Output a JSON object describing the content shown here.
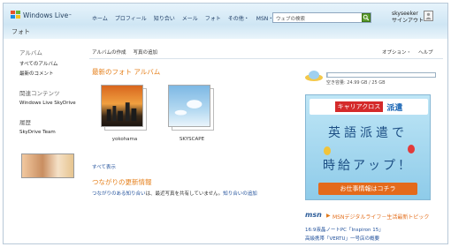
{
  "header": {
    "brand": "Windows Live",
    "trademark": "™",
    "page_title": "フォト",
    "nav": [
      "ホーム",
      "プロフィール",
      "知り合い",
      "メール",
      "フォト",
      "その他・",
      "MSN・"
    ],
    "search_placeholder": "ウェブの検索",
    "user_name": "skyseeker",
    "signout": "サインアウト"
  },
  "sidebar": {
    "album_title": "アルバム",
    "album_items": [
      "すべてのアルバム",
      "最新のコメント"
    ],
    "related_title": "関連コンテンツ",
    "related_items": [
      "Windows Live SkyDrive"
    ],
    "history_title": "履歴",
    "history_items": [
      "SkyDrive Team"
    ]
  },
  "toolbar": {
    "left": [
      "アルバムの作成",
      "写真の追加"
    ],
    "right": [
      "オプション・",
      "ヘルプ"
    ]
  },
  "main": {
    "recent_title": "最新のフォト アルバム",
    "albums": [
      {
        "label": "yokohama"
      },
      {
        "label": "SKYSCAPE"
      }
    ],
    "show_all": "すべて表示",
    "updates_title": "つながりの更新情報",
    "updates_link1": "つながりのある知り合い",
    "updates_text": "は、最近写真を共有していません。",
    "updates_link2": "知り合いの追加"
  },
  "storage": {
    "label": "空き容量: 24.99 GB / 25 GB",
    "used_fraction": 0.004
  },
  "ad": {
    "brand_red": "キャリアクロス",
    "brand_blue": "派遣",
    "line1": "英語派遣で",
    "line2": "時給アップ！",
    "cta": "お仕事情報はコチラ"
  },
  "msn": {
    "logo": "msn",
    "title": "MSNデジタルライフ－生活最新トピック",
    "news": [
      "16:9液晶ノートPC「Inspiron 15」",
      "高級携帯「VERTU」一号店の概要"
    ]
  },
  "colors": {
    "accent_orange": "#e6801c",
    "link_blue": "#1f4f9a"
  }
}
